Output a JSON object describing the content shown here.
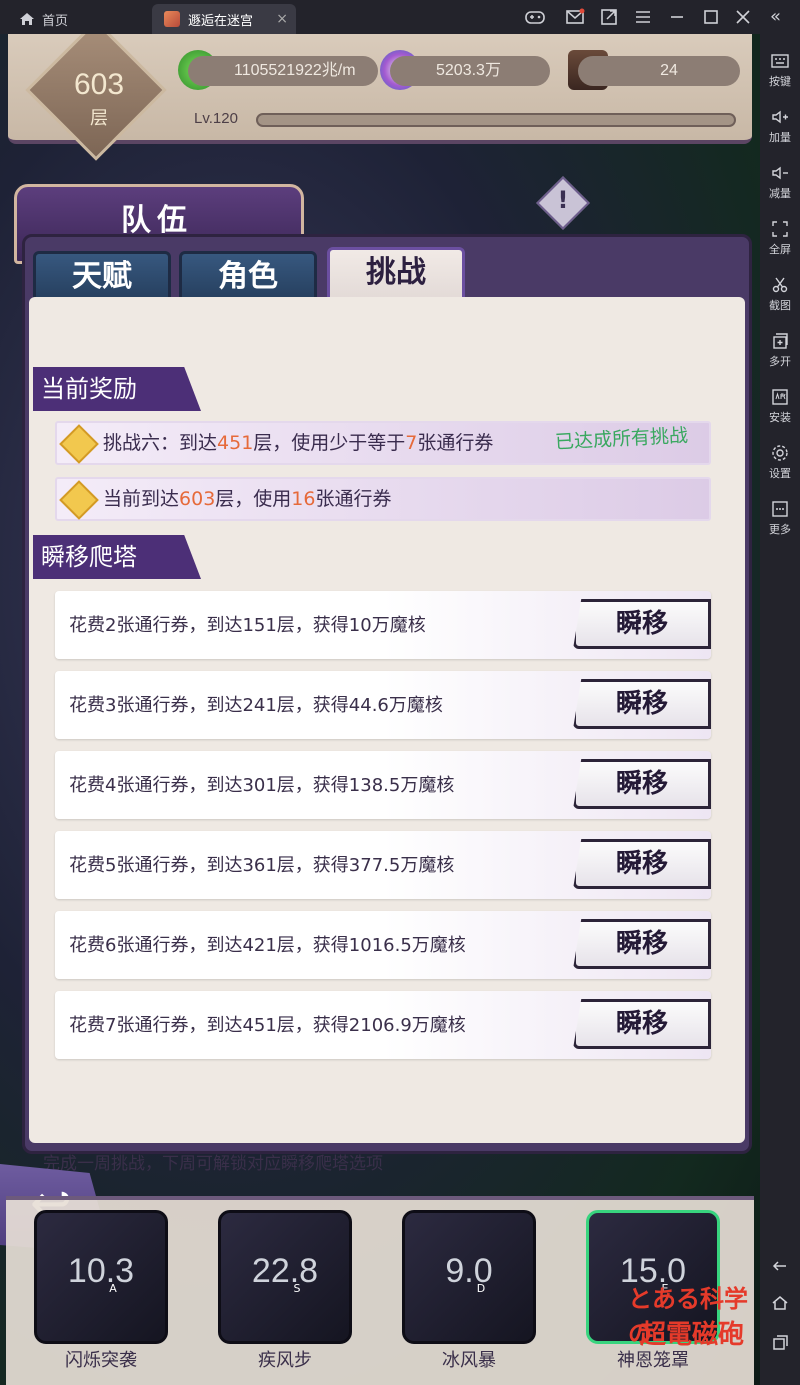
{
  "topbar": {
    "home_tab": "首页",
    "game_tab": "遯逅在迷宫",
    "close_glyph": "×",
    "collapse_glyph": "«"
  },
  "sidebar": {
    "items": [
      {
        "label": "按键",
        "icon": "keyboard-icon"
      },
      {
        "label": "加量",
        "icon": "volume-up-icon"
      },
      {
        "label": "减量",
        "icon": "volume-down-icon"
      },
      {
        "label": "全屏",
        "icon": "fullscreen-icon"
      },
      {
        "label": "截图",
        "icon": "scissors-icon"
      },
      {
        "label": "多开",
        "icon": "multi-instance-icon"
      },
      {
        "label": "安装",
        "icon": "apk-install-icon"
      },
      {
        "label": "设置",
        "icon": "gear-icon"
      },
      {
        "label": "更多",
        "icon": "more-icon"
      }
    ],
    "nav": [
      "back-icon",
      "home-icon",
      "recent-apps-icon"
    ]
  },
  "hud": {
    "floor": "603",
    "floor_unit": "层",
    "exp_value": "1105521922兆/m",
    "crystal_value": "5203.3万",
    "ticket_value": "24",
    "level": "Lv.120"
  },
  "team": {
    "title": "队伍",
    "tabs": [
      "天赋",
      "角色",
      "挑战"
    ],
    "active_tab": 2
  },
  "current_reward": {
    "heading": "当前奖励",
    "row1": {
      "prefix": "挑战六：到达",
      "floor": "451",
      "mid": "层，使用少于等于",
      "count": "7",
      "suffix": "张通行券",
      "done": "已达成所有挑战"
    },
    "row2": {
      "prefix": "当前到达",
      "floor": "603",
      "mid": "层，使用",
      "count": "16",
      "suffix": "张通行券"
    }
  },
  "teleport": {
    "heading": "瞬移爬塔",
    "button_label": "瞬移",
    "rows": [
      "花费2张通行券，到达151层，获得10万魔核",
      "花费3张通行券，到达241层，获得44.6万魔核",
      "花费4张通行券，到达301层，获得138.5万魔核",
      "花费5张通行券，到达361层，获得377.5万魔核",
      "花费6张通行券，到达421层，获得1016.5万魔核",
      "花费7张通行券，到达451层，获得2106.9万魔核"
    ],
    "footnote": "完成一周挑战，下周可解锁对应瞬移爬塔选项"
  },
  "skills": [
    {
      "cd": "10.3",
      "key": "A",
      "name": "闪烁突袭"
    },
    {
      "cd": "22.8",
      "key": "S",
      "name": "疾风步"
    },
    {
      "cd": "9.0",
      "key": "D",
      "name": "冰风暴"
    },
    {
      "cd": "15.0",
      "key": "E",
      "name": "神恩笼罩"
    }
  ],
  "watermark": {
    "line1": "とある科学の",
    "line2": "超電磁砲"
  },
  "colors": {
    "accent_purple": "#4c2f77",
    "highlight_orange": "#e66a3a",
    "done_green": "#3aa860"
  }
}
